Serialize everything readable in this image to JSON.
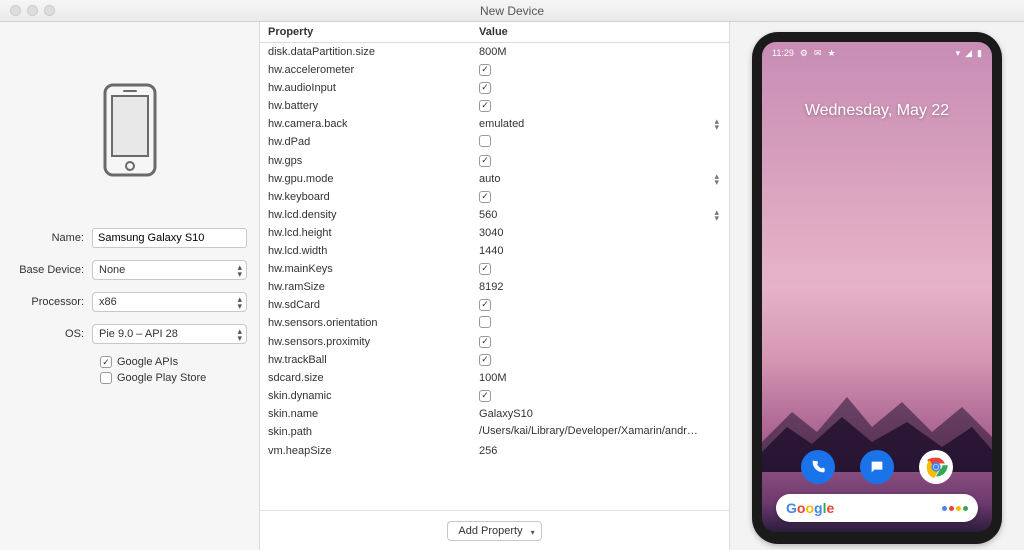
{
  "window": {
    "title": "New Device"
  },
  "form": {
    "name_label": "Name:",
    "name_value": "Samsung Galaxy S10",
    "base_label": "Base Device:",
    "base_value": "None",
    "proc_label": "Processor:",
    "proc_value": "x86",
    "os_label": "OS:",
    "os_value": "Pie 9.0 – API 28",
    "google_apis_label": "Google APIs",
    "google_apis_checked": true,
    "play_store_label": "Google Play Store",
    "play_store_checked": false
  },
  "table": {
    "header_property": "Property",
    "header_value": "Value",
    "rows": [
      {
        "prop": "disk.dataPartition.size",
        "type": "text",
        "value": "800M"
      },
      {
        "prop": "hw.accelerometer",
        "type": "check",
        "checked": true
      },
      {
        "prop": "hw.audioInput",
        "type": "check",
        "checked": true
      },
      {
        "prop": "hw.battery",
        "type": "check",
        "checked": true
      },
      {
        "prop": "hw.camera.back",
        "type": "select",
        "value": "emulated"
      },
      {
        "prop": "hw.dPad",
        "type": "check",
        "checked": false
      },
      {
        "prop": "hw.gps",
        "type": "check",
        "checked": true
      },
      {
        "prop": "hw.gpu.mode",
        "type": "select",
        "value": "auto"
      },
      {
        "prop": "hw.keyboard",
        "type": "check",
        "checked": true
      },
      {
        "prop": "hw.lcd.density",
        "type": "select",
        "value": "560"
      },
      {
        "prop": "hw.lcd.height",
        "type": "text",
        "value": "3040"
      },
      {
        "prop": "hw.lcd.width",
        "type": "text",
        "value": "1440"
      },
      {
        "prop": "hw.mainKeys",
        "type": "check",
        "checked": true
      },
      {
        "prop": "hw.ramSize",
        "type": "text",
        "value": "8192"
      },
      {
        "prop": "hw.sdCard",
        "type": "check",
        "checked": true
      },
      {
        "prop": "hw.sensors.orientation",
        "type": "check",
        "checked": false
      },
      {
        "prop": "hw.sensors.proximity",
        "type": "check",
        "checked": true
      },
      {
        "prop": "hw.trackBall",
        "type": "check",
        "checked": true
      },
      {
        "prop": "sdcard.size",
        "type": "text",
        "value": "100M"
      },
      {
        "prop": "skin.dynamic",
        "type": "check",
        "checked": true
      },
      {
        "prop": "skin.name",
        "type": "text",
        "value": "GalaxyS10"
      },
      {
        "prop": "skin.path",
        "type": "text",
        "value": "/Users/kai/Library/Developer/Xamarin/android-..."
      },
      {
        "prop": "vm.heapSize",
        "type": "text",
        "value": "256"
      }
    ]
  },
  "add_property_label": "Add Property",
  "preview": {
    "status_time": "11:29",
    "lock_date": "Wednesday, May 22"
  }
}
